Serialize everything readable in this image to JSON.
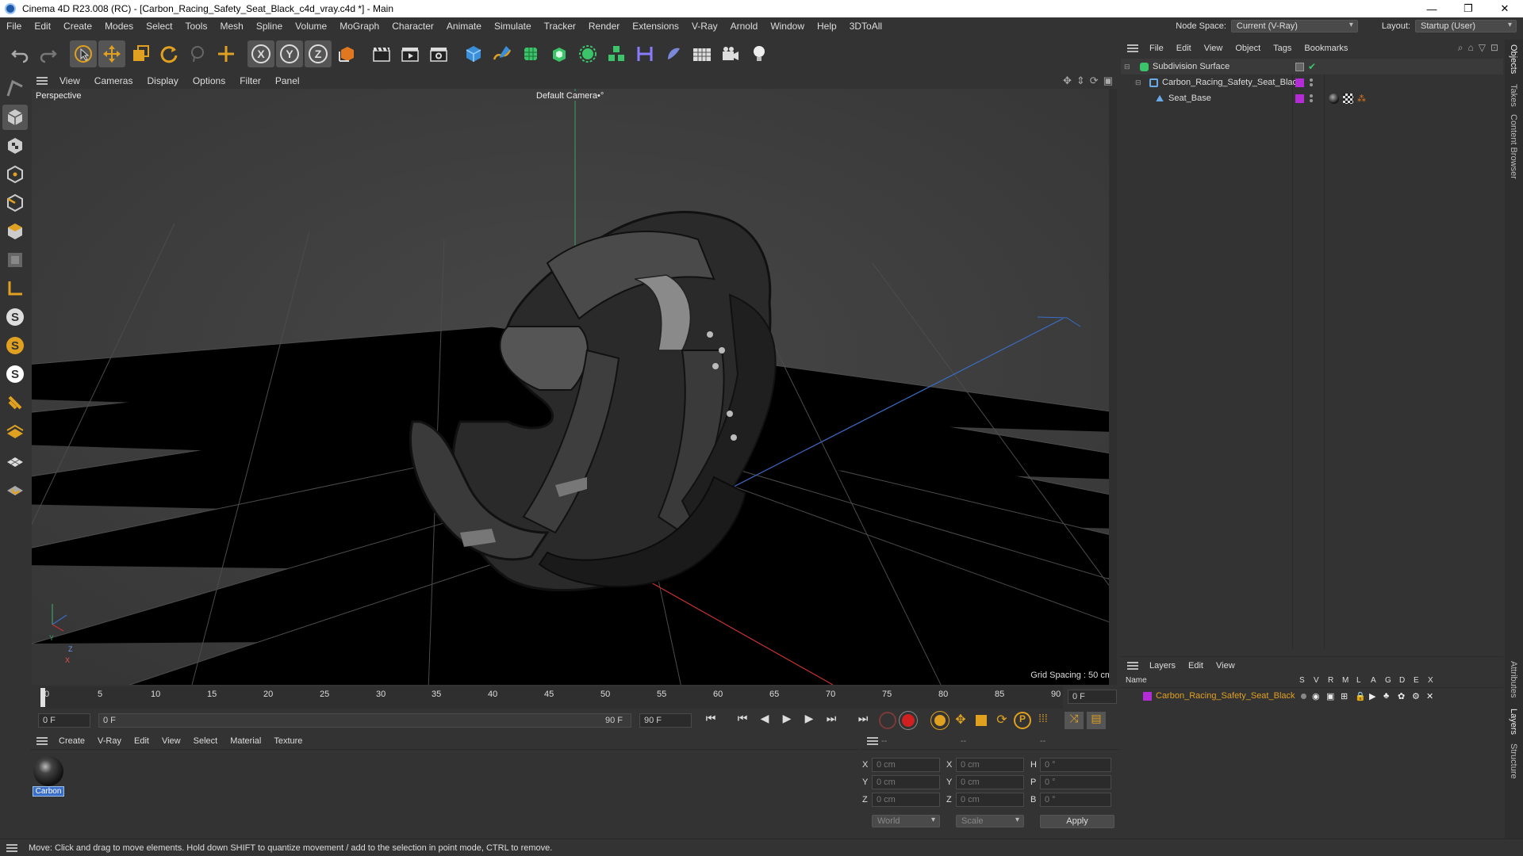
{
  "window": {
    "title": "Cinema 4D R23.008 (RC) - [Carbon_Racing_Safety_Seat_Black_c4d_vray.c4d *] - Main",
    "minimize": "—",
    "maximize": "❐",
    "close": "✕"
  },
  "menu": [
    "File",
    "Edit",
    "Create",
    "Modes",
    "Select",
    "Tools",
    "Mesh",
    "Spline",
    "Volume",
    "MoGraph",
    "Character",
    "Animate",
    "Simulate",
    "Tracker",
    "Render",
    "Extensions",
    "V-Ray",
    "Arnold",
    "Window",
    "Help",
    "3DToAll"
  ],
  "node_space": {
    "label": "Node Space:",
    "value": "Current (V-Ray)"
  },
  "layout": {
    "label": "Layout:",
    "value": "Startup (User)"
  },
  "viewport": {
    "menu": [
      "View",
      "Cameras",
      "Display",
      "Options",
      "Filter",
      "Panel"
    ],
    "label": "Perspective",
    "camera": "Default Camera",
    "camera_icon": "•°",
    "grid_spacing": "Grid Spacing : 50 cm",
    "axis": {
      "y": "Y",
      "z": "Z",
      "x": "X"
    }
  },
  "timeline": {
    "ticks": [
      "0",
      "5",
      "10",
      "15",
      "20",
      "25",
      "30",
      "35",
      "40",
      "45",
      "50",
      "55",
      "60",
      "65",
      "70",
      "75",
      "80",
      "85",
      "90"
    ],
    "end_field": "0 F"
  },
  "transport": {
    "start": "0 F",
    "range_start": "0 F",
    "range_end": "90 F",
    "end": "90 F"
  },
  "material_manager": {
    "menu": [
      "Create",
      "V-Ray",
      "Edit",
      "View",
      "Select",
      "Material",
      "Texture"
    ],
    "materials": [
      {
        "name": "Carbon"
      }
    ]
  },
  "coord_manager": {
    "headers": [
      "--",
      "--",
      "--"
    ],
    "rows": [
      {
        "a": "X",
        "av": "0 cm",
        "b": "X",
        "bv": "0 cm",
        "c": "H",
        "cv": "0 °"
      },
      {
        "a": "Y",
        "av": "0 cm",
        "b": "Y",
        "bv": "0 cm",
        "c": "P",
        "cv": "0 °"
      },
      {
        "a": "Z",
        "av": "0 cm",
        "b": "Z",
        "bv": "0 cm",
        "c": "B",
        "cv": "0 °"
      }
    ],
    "world": "World",
    "scale": "Scale",
    "apply": "Apply"
  },
  "object_manager": {
    "menu": [
      "File",
      "Edit",
      "View",
      "Object",
      "Tags",
      "Bookmarks"
    ],
    "objects": [
      {
        "name": "Subdivision Surface"
      },
      {
        "name": "Carbon_Racing_Safety_Seat_Black"
      },
      {
        "name": "Seat_Base"
      }
    ]
  },
  "layer_manager": {
    "menu": [
      "Layers",
      "Edit",
      "View"
    ],
    "header_name": "Name",
    "columns": [
      "S",
      "V",
      "R",
      "M",
      "L",
      "A",
      "G",
      "D",
      "E",
      "X"
    ],
    "layers": [
      {
        "name": "Carbon_Racing_Safety_Seat_Black"
      }
    ]
  },
  "right_tabs": {
    "objects": "Objects",
    "takes": "Takes",
    "content_browser": "Content Browser",
    "attributes": "Attributes",
    "layers": "Layers",
    "structure": "Structure"
  },
  "status": "Move: Click and drag to move elements. Hold down SHIFT to quantize movement / add to the selection in point mode, CTRL to remove.",
  "colors": {
    "accent": "#b32cd6",
    "layer_text": "#e0a020",
    "record": "#d02020"
  }
}
